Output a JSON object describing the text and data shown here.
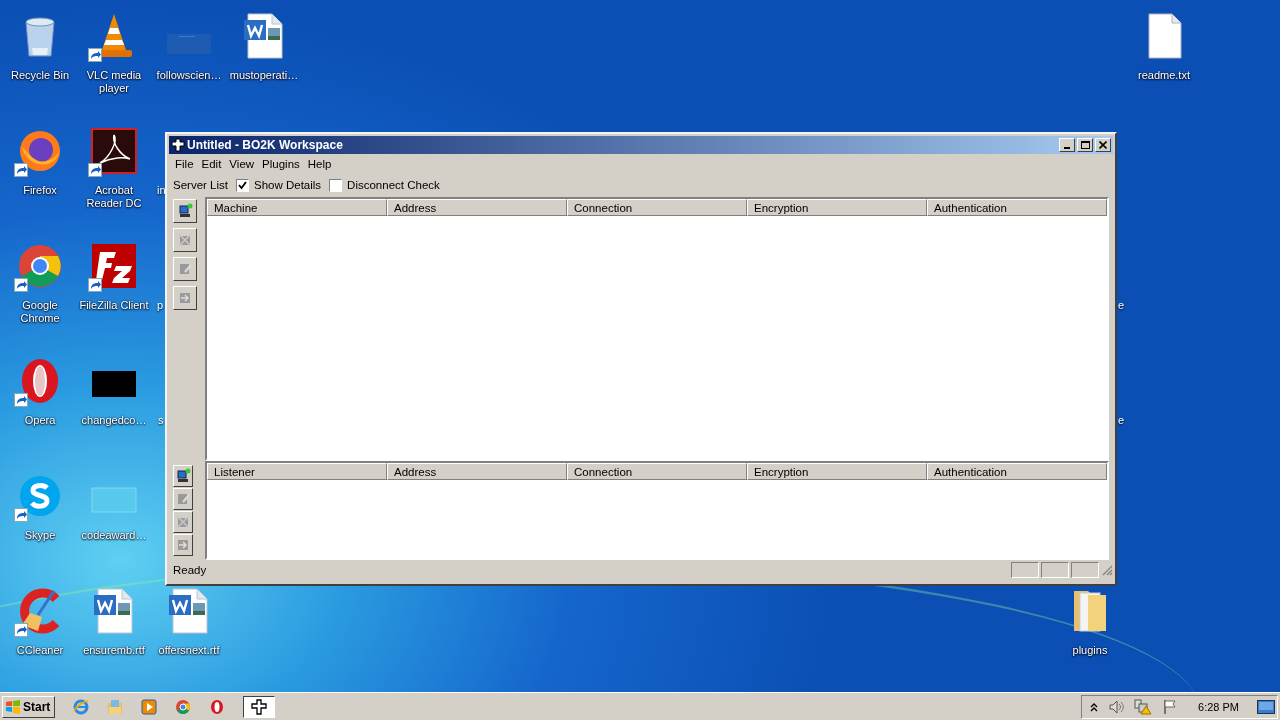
{
  "desktop": {
    "icons": [
      {
        "kind": "recycle",
        "label": "Recycle Bin",
        "shortcut": false
      },
      {
        "kind": "cone",
        "label": "VLC media player",
        "shortcut": true
      },
      {
        "kind": "faint",
        "label": "followscien…",
        "shortcut": false
      },
      {
        "kind": "word",
        "label": "mustoperati…",
        "shortcut": false
      },
      {
        "kind": "text",
        "label": "readme.txt",
        "shortcut": false
      },
      {
        "kind": "firefox",
        "label": "Firefox",
        "shortcut": true
      },
      {
        "kind": "acrobat",
        "label": "Acrobat Reader DC",
        "shortcut": true
      },
      {
        "kind": "chrome",
        "label": "Google Chrome",
        "shortcut": true
      },
      {
        "kind": "filezilla",
        "label": "FileZilla Client",
        "shortcut": true
      },
      {
        "kind": "opera",
        "label": "Opera",
        "shortcut": true
      },
      {
        "kind": "black",
        "label": "changedco…",
        "shortcut": false
      },
      {
        "kind": "skype",
        "label": "Skype",
        "shortcut": true
      },
      {
        "kind": "pale",
        "label": "codeaward…",
        "shortcut": false
      },
      {
        "kind": "ccleaner",
        "label": "CCleaner",
        "shortcut": true
      },
      {
        "kind": "word",
        "label": "ensuremb.rtf",
        "shortcut": false
      },
      {
        "kind": "word",
        "label": "offersnext.rtf",
        "shortcut": false
      },
      {
        "kind": "folder",
        "label": "plugins",
        "shortcut": false
      }
    ],
    "clipped_labels": [
      "in",
      "p",
      "s",
      "e",
      "e"
    ]
  },
  "window": {
    "title": "Untitled - BO2K Workspace",
    "menu": [
      "File",
      "Edit",
      "View",
      "Plugins",
      "Help"
    ],
    "toolbar": {
      "label": "Server List",
      "options": [
        {
          "label": "Show Details",
          "checked": true
        },
        {
          "label": "Disconnect Check",
          "checked": false
        }
      ]
    },
    "server_buttons": [
      {
        "kind": "add",
        "disabled": false
      },
      {
        "kind": "remove",
        "disabled": true
      },
      {
        "kind": "edit",
        "disabled": true
      },
      {
        "kind": "connect",
        "disabled": true
      }
    ],
    "servers": {
      "columns": [
        "Machine",
        "Address",
        "Connection",
        "Encryption",
        "Authentication"
      ]
    },
    "listener_buttons": [
      {
        "kind": "add",
        "disabled": false
      },
      {
        "kind": "edit",
        "disabled": true
      },
      {
        "kind": "remove",
        "disabled": true
      },
      {
        "kind": "connect",
        "disabled": true
      }
    ],
    "listeners": {
      "columns": [
        "Listener",
        "Address",
        "Connection",
        "Encryption",
        "Authentication"
      ]
    },
    "status_bar": {
      "text": "Ready"
    }
  },
  "taskbar": {
    "start": "Start",
    "quick_launch": [
      {
        "kind": "ie"
      },
      {
        "kind": "explorer"
      },
      {
        "kind": "media"
      },
      {
        "kind": "chrome"
      },
      {
        "kind": "opera"
      }
    ],
    "tasks": [
      {
        "kind": "bo2k",
        "selected": true
      }
    ],
    "clock": "6:28 PM"
  }
}
